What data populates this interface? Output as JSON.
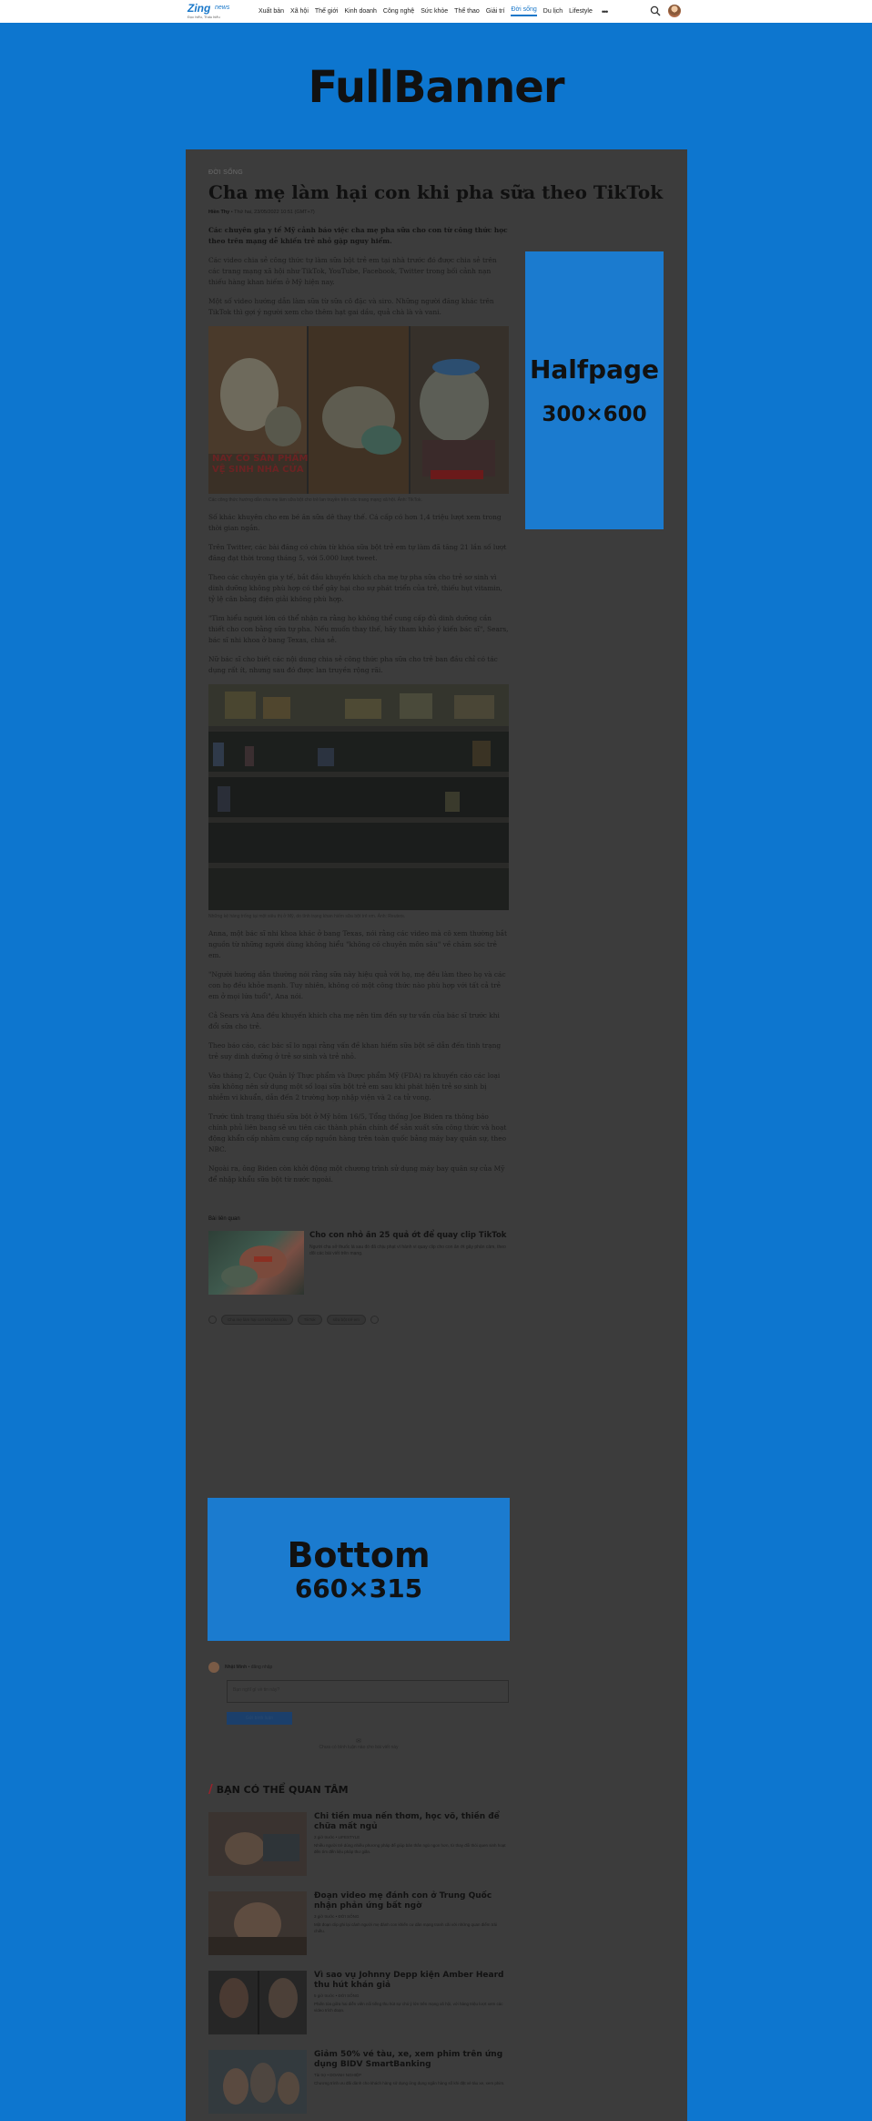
{
  "topbar": {
    "logo": {
      "brand": "Zing",
      "brand_suffix": "news",
      "slogan": "Đọc hiểu, Thấu hiểu"
    },
    "nav": [
      "Xuất bản",
      "Xã hội",
      "Thế giới",
      "Kinh doanh",
      "Công nghệ",
      "Sức khỏe",
      "Thể thao",
      "Giải trí",
      "Đời sống",
      "Du lịch",
      "Lifestyle"
    ],
    "active_nav": "Đời sống",
    "more": "•••",
    "icons": [
      "search-icon",
      "user-avatar"
    ]
  },
  "full_banner": {
    "label": "FullBanner",
    "color": "#0d76cf"
  },
  "half_banner": {
    "label": "Halfpage",
    "size": "300×600"
  },
  "bottom_banner": {
    "label": "Bottom",
    "size": "660×315"
  },
  "article": {
    "category": "ĐỜI SỐNG",
    "title": "Cha mẹ làm hại con khi pha sữa theo TikTok",
    "author": "Hiền Thy",
    "date": "Thứ hai, 23/05/2022 10:51 (GMT+7)",
    "sapo": "Các chuyên gia y tế Mỹ cảnh báo việc cha mẹ pha sữa cho con từ công thức học theo trên mạng dễ khiến trẻ nhỏ gặp nguy hiểm.",
    "paragraphs_a": [
      "Các video chia sẻ công thức tự làm sữa bột trẻ em tại nhà trước đó được chia sẻ trên các trang mạng xã hội như TikTok, YouTube, Facebook, Twitter trong bối cảnh nạn thiếu hàng khan hiếm ở Mỹ hiện nay.",
      "Một số video hướng dẫn làm sữa từ sữa cô đặc và siro. Những người đăng khác trên TikTok thì gợi ý người xem cho thêm hạt gai dầu, quả chà là và vani."
    ],
    "image1": {
      "banner_line1": "NAY CÓ SẢN PHẨM",
      "banner_line2": "VỆ SINH NHÀ CỬA",
      "caption": "Các công thức hướng dẫn cha mẹ làm sữa bột cho trẻ lan truyền trên các trang mạng xã hội. Ảnh: TikTok."
    },
    "paragraphs_b": [
      "Số khác khuyên cho em bé ăn sữa dê thay thế. Cá cấp có hơn 1,4 triệu lượt xem trong thời gian ngắn.",
      "Trên Twitter, các bài đăng có chứa từ khóa sữa bột trẻ em tự làm đã tăng 21 lần số lượt đăng đạt thời trong tháng 5, với 5.000 lượt tweet.",
      "Theo các chuyên gia y tế, bắt đầu khuyến khích cha mẹ tự pha sữa cho trẻ sơ sinh vì dinh dưỡng không phù hợp có thể gây hại cho sự phát triển của trẻ, thiếu hụt vitamin, tỷ lệ cân bằng điện giải không phù hợp.",
      "\"Tìm hiểu người lớn có thể nhận ra rằng họ không thể cung cấp đủ dinh dưỡng cần thiết cho con bằng sữa tự pha. Nếu muốn thay thế, hãy tham khảo ý kiến bác sĩ\", Sears, bác sĩ nhi khoa ở bang Texas, chia sẻ.",
      "Nữ bác sĩ cho biết các nội dung chia sẻ công thức pha sữa cho trẻ ban đầu chỉ có tác dụng rất ít, nhưng sau đó được lan truyền rộng rãi."
    ],
    "image2": {
      "caption": "Những kệ hàng trống tại một siêu thị ở Mỹ, do tình trạng khan hiếm sữa bột trẻ em. Ảnh: Reuters."
    },
    "paragraphs_c": [
      "Anna, một bác sĩ nhi khoa khác ở bang Texas, nói rằng các video mà cô xem thường bắt nguồn từ những người dùng không hiểu \"không có chuyên môn sâu\" về chăm sóc trẻ em.",
      "\"Người hướng dẫn thường nói rằng sữa này hiệu quả với họ, mẹ đều làm theo họ và các con họ đều khỏe mạnh. Tuy nhiên, không có một công thức nào phù hợp với tất cả trẻ em ở mọi lứa tuổi\", Ana nói.",
      "Cả Sears và Ana đều khuyến khích cha mẹ nên tìm đến sự tư vấn của bác sĩ trước khi đổi sữa cho trẻ.",
      "Theo báo cáo, các bác sĩ lo ngại rằng vấn đề khan hiếm sữa bột sẽ dẫn đến tình trạng trẻ suy dinh dưỡng ở trẻ sơ sinh và trẻ nhỏ.",
      "Vào tháng 2, Cục Quản lý Thực phẩm và Dược phẩm Mỹ (FDA) ra khuyến cáo các loại sữa không nên sử dụng một số loại sữa bột trẻ em sau khi phát hiện trẻ sơ sinh bị nhiễm vi khuẩn, dẫn đến 2 trường hợp nhập viện và 2 ca tử vong.",
      "Trước tình trạng thiếu sữa bột ở Mỹ hôm 16/5, Tổng thống Joe Biden ra thông báo chính phủ liên bang sẽ ưu tiên các thành phần chính để sản xuất sữa công thức và hoạt động khẩn cấp nhằm cung cấp nguồn hàng trên toàn quốc bằng máy bay quân sự, theo NBC.",
      "Ngoài ra, ông Biden còn khởi động một chương trình sử dụng máy bay quân sự của Mỹ để nhập khẩu sữa bột từ nước ngoài."
    ]
  },
  "related": {
    "heading": "Bài liên quan",
    "title": "Cho con nhỏ ăn 25 quả ớt để quay clip TikTok",
    "desc": "Người cha sở thuốc lá sau đó đã chịu phạt vì hành vi quay clip cho con ăn ớt gây phản cảm, theo dõi các bài viết trên mạng."
  },
  "tags": [
    "Cha mẹ làm hại con khi pha sữa",
    "TikTok",
    "sữa bột trẻ em"
  ],
  "comment": {
    "user": "Nhật Minh",
    "user_meta": "• đăng nhập",
    "placeholder": "Bạn nghĩ gì về tin này?",
    "send": "Gửi bình luận",
    "empty": "Chưa có bình luận nào cho bài viết này"
  },
  "suggest": {
    "heading": "BẠN CÓ THỂ QUAN TÂM",
    "items": [
      {
        "title": "Chi tiền mua nến thơm, học võ, thiền để chữa mất ngủ",
        "meta": "2 giờ trước • LIFESTYLE",
        "desc": "Nhiều người trẻ dùng nhiều phương pháp để giúp bản thân ngủ ngon hơn, từ thay đổi thói quen sinh hoạt đến tìm đến liệu pháp thư giãn."
      },
      {
        "title": "Đoạn video mẹ đánh con ở Trung Quốc nhận phản ứng bất ngờ",
        "meta": "3 giờ trước • ĐỜI SỐNG",
        "desc": "Một đoạn clip ghi lại cảnh người mẹ đánh con khiến cư dân mạng tranh cãi với những quan điểm trái chiều."
      },
      {
        "title": "Vì sao vụ Johnny Depp kiện Amber Heard thu hút khán giả",
        "meta": "5 giờ trước • ĐỜI SỐNG",
        "desc": "Phiên tòa giữa hai diễn viên nổi tiếng thu hút sự chú ý lớn trên mạng xã hội, với hàng triệu lượt xem các video trích đoạn."
      },
      {
        "title": "Giảm 50% vé tàu, xe, xem phim trên ứng dụng BIDV SmartBanking",
        "meta": "Tài trợ • DOANH NGHIỆP",
        "desc": "Chương trình ưu đãi dành cho khách hàng sử dụng ứng dụng ngân hàng số khi đặt vé tàu xe, xem phim."
      }
    ]
  }
}
